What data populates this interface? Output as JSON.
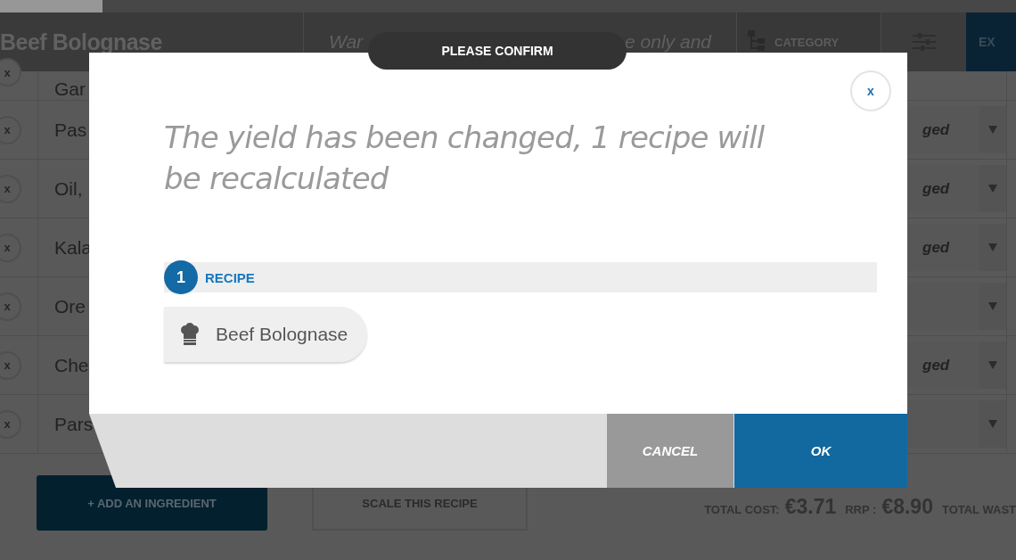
{
  "header": {
    "title": "Beef Bolognase",
    "description_start": "War",
    "description_end": "e only and",
    "category_button": "CATEGORY",
    "export_button": "EX"
  },
  "ingredients": [
    {
      "kind": "partial",
      "remove": "x",
      "name": "Gar"
    },
    {
      "kind": "full",
      "remove": "x",
      "name": "Pas",
      "status": "ged"
    },
    {
      "kind": "full",
      "remove": "x",
      "name": "Oil,",
      "status": "ged"
    },
    {
      "kind": "full",
      "remove": "x",
      "name": "Kala",
      "status": "ged"
    },
    {
      "kind": "full",
      "remove": "x",
      "name": "Ore"
    },
    {
      "kind": "full",
      "remove": "x",
      "name": "Che",
      "status": "ged"
    },
    {
      "kind": "full",
      "remove": "x",
      "name": "Pars"
    }
  ],
  "footer": {
    "add_button": "+ ADD AN INGREDIENT",
    "scale_button": "SCALE THIS RECIPE",
    "total_cost_label": "TOTAL COST:",
    "total_cost": "€3.71",
    "rrp_label": "RRP :",
    "rrp": "€8.90",
    "waste_label": "TOTAL WAST"
  },
  "dialog": {
    "title": "PLEASE CONFIRM",
    "close": "x",
    "message": "The yield has been changed, 1 recipe will be recalculated",
    "section_count": "1",
    "section_label": "RECIPE",
    "recipes": [
      {
        "name": "Beef Bolognase"
      }
    ],
    "cancel": "CANCEL",
    "ok": "OK"
  }
}
